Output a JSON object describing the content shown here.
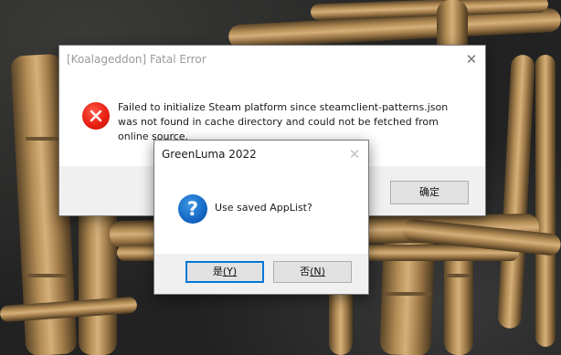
{
  "error_dialog": {
    "title": "[Koalageddon] Fatal Error",
    "close_glyph": "✕",
    "icon": "error-icon",
    "message": "Failed to initialize Steam platform since steamclient-patterns.json was not found in cache directory and could not be fetched from online source.",
    "ok_label": "确定"
  },
  "question_dialog": {
    "title": "GreenLuma 2022",
    "close_glyph": "✕",
    "icon": "question-icon",
    "icon_glyph": "?",
    "message": "Use saved AppList?",
    "yes_label": "是",
    "yes_accel": "(Y)",
    "no_label": "否",
    "no_accel": "(N)"
  },
  "colors": {
    "error_icon": "#e81f12",
    "question_icon": "#1468c4",
    "default_button_border": "#0078d7",
    "footer_bg": "#f0f0f0"
  }
}
